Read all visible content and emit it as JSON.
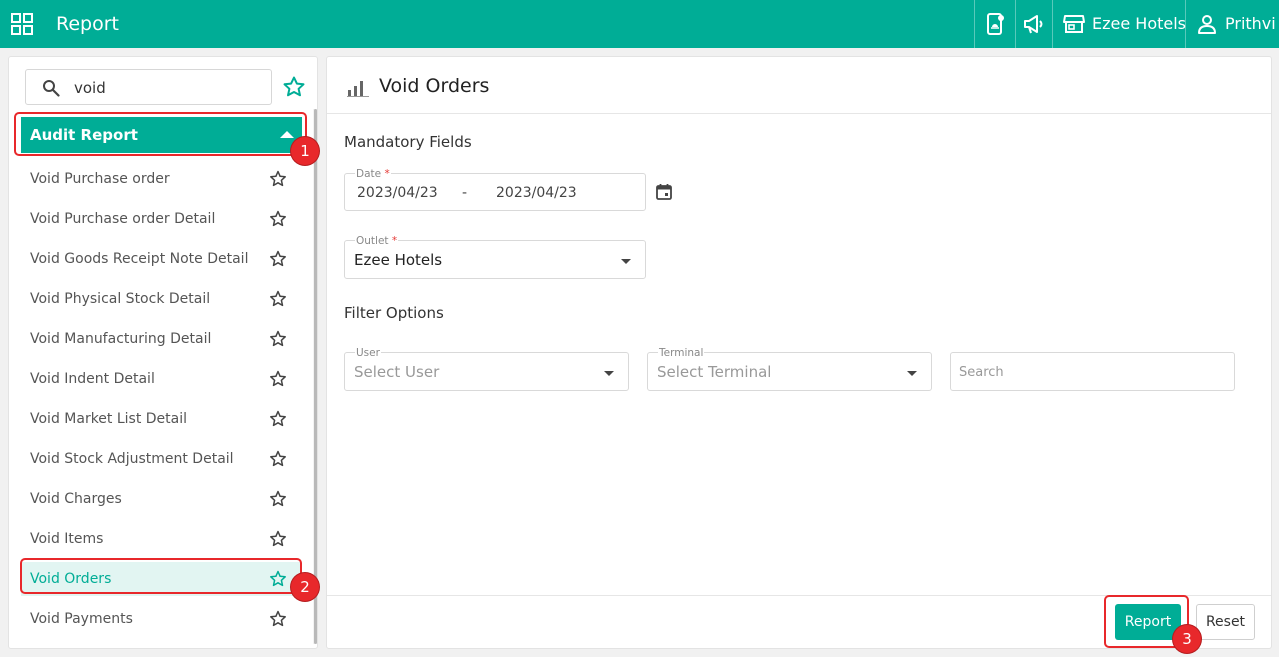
{
  "app": {
    "title": "Report",
    "hotel": "Ezee Hotels",
    "user": "Prithvi"
  },
  "sidebar": {
    "search_value": "void",
    "group": "Audit Report",
    "items": [
      {
        "label": "Void Purchase order"
      },
      {
        "label": "Void Purchase order Detail"
      },
      {
        "label": "Void Goods Receipt Note Detail"
      },
      {
        "label": "Void Physical Stock Detail"
      },
      {
        "label": "Void Manufacturing Detail"
      },
      {
        "label": "Void Indent Detail"
      },
      {
        "label": "Void Market List Detail"
      },
      {
        "label": "Void Stock Adjustment Detail"
      },
      {
        "label": "Void Charges"
      },
      {
        "label": "Void Items"
      },
      {
        "label": "Void Orders"
      },
      {
        "label": "Void Payments"
      }
    ],
    "active_item": "Void Orders"
  },
  "main": {
    "title": "Void Orders",
    "mandatory_title": "Mandatory Fields",
    "date": {
      "label": "Date",
      "required_mark": "*",
      "from": "2023/04/23",
      "separator": "-",
      "to": "2023/04/23"
    },
    "outlet": {
      "label": "Outlet",
      "required_mark": "*",
      "value": "Ezee Hotels"
    },
    "filter_title": "Filter Options",
    "user": {
      "label": "User",
      "placeholder": "Select User"
    },
    "terminal": {
      "label": "Terminal",
      "placeholder": "Select Terminal"
    },
    "search": {
      "placeholder": "Search"
    },
    "buttons": {
      "report": "Report",
      "reset": "Reset"
    }
  },
  "annotations": [
    "1",
    "2",
    "3"
  ],
  "colors": {
    "accent": "#00ad96",
    "highlight": "#e8282b",
    "active_bg": "#e2f5f2"
  }
}
